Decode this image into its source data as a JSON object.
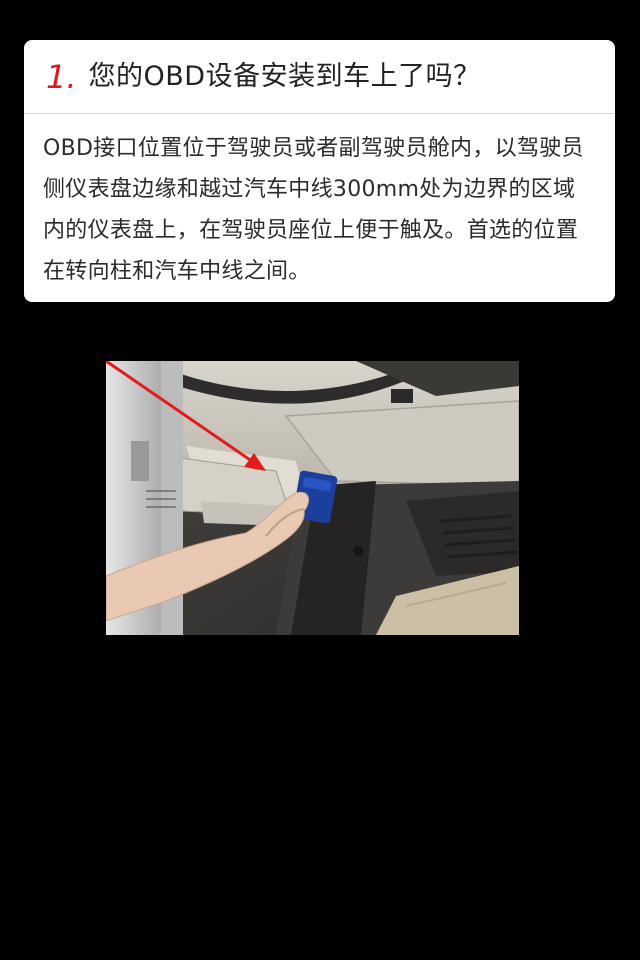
{
  "step": {
    "number": "1.",
    "title": "您的OBD设备安装到车上了吗？",
    "description": "OBD接口位置位于驾驶员或者副驾驶员舱内，以驾驶员侧仪表盘边缘和越过汽车中线300mm处为边界的区域内的仪表盘上，在驾驶员座位上便于触及。首选的位置在转向柱和汽车中线之间。"
  },
  "colors": {
    "background": "#000000",
    "card": "#ffffff",
    "accent_number": "#e8141b",
    "arrow": "#e31b1b",
    "obd_device": "#1c3f9c"
  }
}
